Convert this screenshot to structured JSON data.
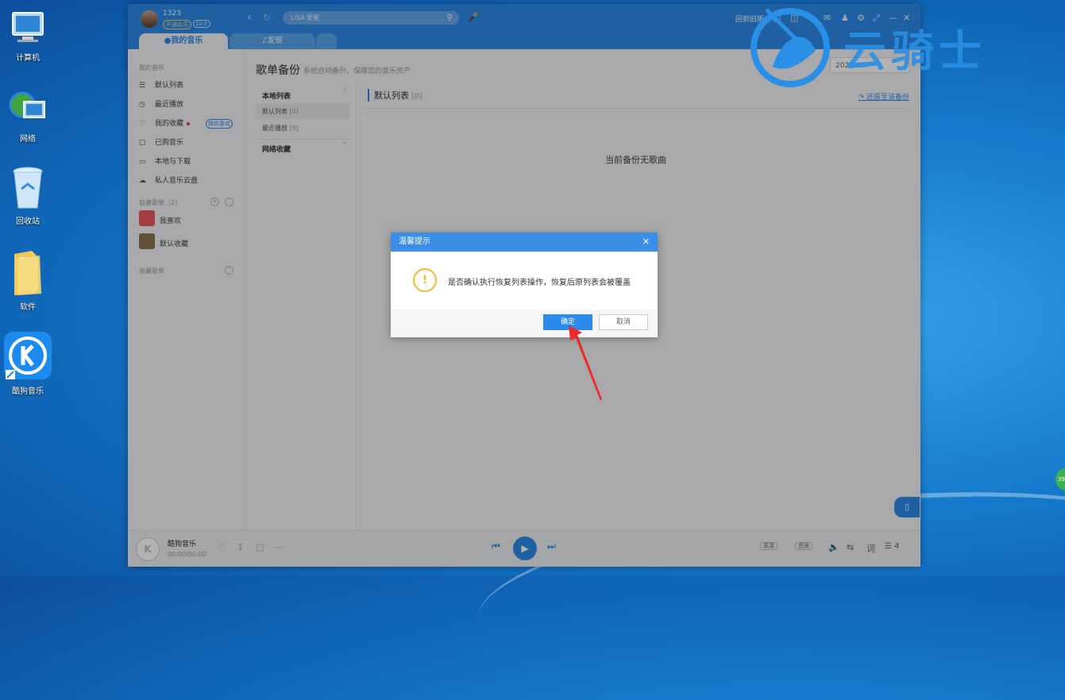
{
  "desktop": {
    "icons": [
      {
        "label": "计算机"
      },
      {
        "label": "网络"
      },
      {
        "label": "回收站"
      },
      {
        "label": "软件"
      },
      {
        "label": "酷狗音乐"
      }
    ],
    "tray_badge": "39"
  },
  "topbar": {
    "username": "1323",
    "vip_badge": "开通会员",
    "level_badge": "LV.0",
    "search_placeholder": "LISA 爱蜜",
    "back_to_old": "回到旧版",
    "tabs": [
      {
        "label": "我的音乐"
      },
      {
        "label": "发现"
      }
    ]
  },
  "sidebar": {
    "my_music_heading": "我的音乐",
    "items": [
      {
        "label": "默认列表"
      },
      {
        "label": "最近播放"
      },
      {
        "label": "我的收藏"
      },
      {
        "label": "已购音乐"
      },
      {
        "label": "本地与下载"
      },
      {
        "label": "私人音乐云盘"
      }
    ],
    "guess_badge": "猜你喜欢",
    "created_heading": "自建歌单（2）",
    "playlists": [
      {
        "label": "我喜欢"
      },
      {
        "label": "默认收藏"
      }
    ],
    "collected_heading": "收藏歌单"
  },
  "content": {
    "title": "歌单备份",
    "subtitle": "系统自动备份，保障您的音乐资产",
    "date_select": "2020-0...",
    "local_section": "本地列表",
    "local_items": [
      {
        "label": "默认列表",
        "count": "[0]"
      },
      {
        "label": "最近播放",
        "count": "[0]"
      }
    ],
    "network_section": "网络收藏",
    "list_title": "默认列表",
    "list_count": "[0]",
    "restore_link": "还原至该备份",
    "empty_message": "当前备份无歌曲"
  },
  "player": {
    "track": "酷狗音乐",
    "time": "00:00/00:00",
    "quality": "高清",
    "effect": "音效",
    "lyrics": "词",
    "queue_count": "4"
  },
  "dialog": {
    "title": "温馨提示",
    "message": "是否确认执行恢复列表操作，恢复后原列表会被覆盖",
    "ok_label": "确定",
    "cancel_label": "取消"
  },
  "watermark": {
    "text": "云骑士"
  },
  "colors": {
    "accent": "#2c8ae8",
    "warning": "#f3b92b",
    "arrow": "#ee2b2b"
  }
}
